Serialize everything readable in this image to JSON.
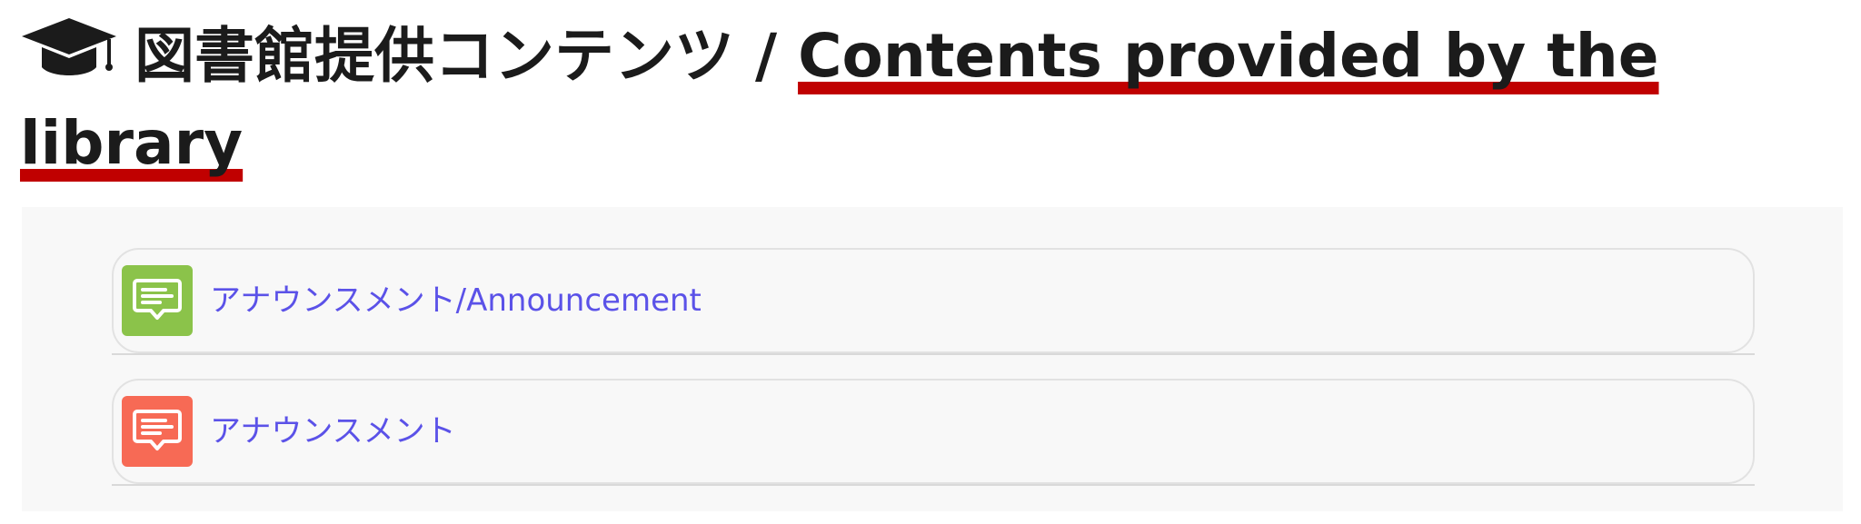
{
  "heading": {
    "icon": "graduation-cap-icon",
    "title_jp": "図書館提供コンテンツ",
    "separator": " / ",
    "title_en": "Contents provided by the library"
  },
  "items": [
    {
      "label": "アナウンスメント/Announcement",
      "icon": "announcement-icon",
      "icon_color": "#8bc34a"
    },
    {
      "label": "アナウンスメント",
      "icon": "announcement-icon",
      "icon_color": "#f76a55"
    }
  ],
  "colors": {
    "title_text": "#1b1b1b",
    "underline": "#c00000",
    "link": "#5b52e8",
    "panel_bg": "#f8f8f8"
  }
}
